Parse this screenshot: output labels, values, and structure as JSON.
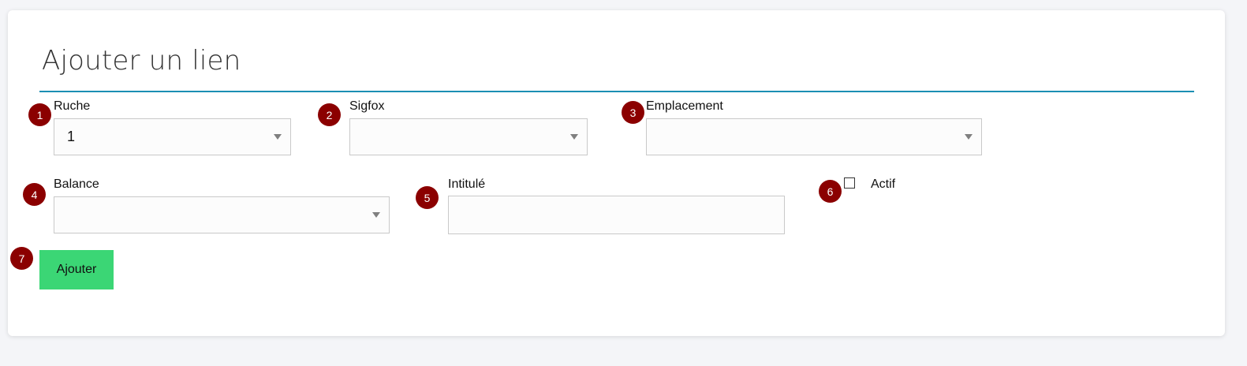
{
  "form": {
    "title": "Ajouter un lien",
    "fields": {
      "ruche": {
        "label": "Ruche",
        "value": "1"
      },
      "sigfox": {
        "label": "Sigfox",
        "value": ""
      },
      "emplacement": {
        "label": "Emplacement",
        "value": ""
      },
      "balance": {
        "label": "Balance",
        "value": ""
      },
      "intitule": {
        "label": "Intitulé",
        "value": ""
      },
      "actif": {
        "label": "Actif",
        "checked": false
      }
    },
    "submit_label": "Ajouter"
  },
  "annotations": [
    "1",
    "2",
    "3",
    "4",
    "5",
    "6",
    "7"
  ],
  "colors": {
    "accent_rule": "#1b8fb3",
    "button": "#3bd675",
    "badge": "#8b0000"
  }
}
